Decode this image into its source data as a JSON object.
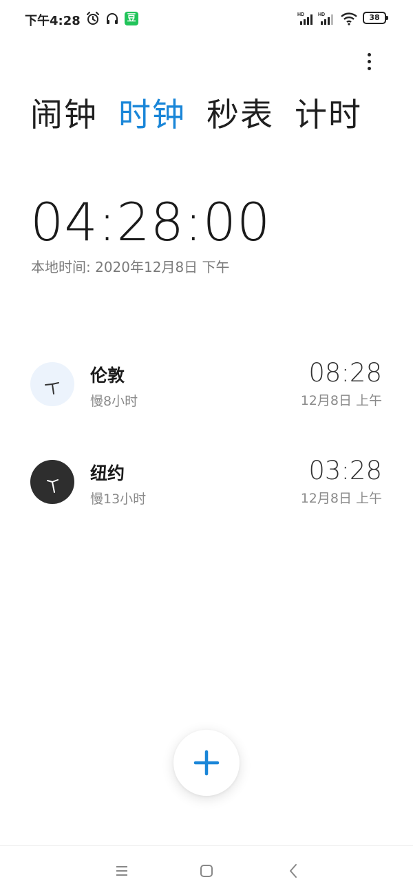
{
  "status_bar": {
    "time": "下午4:28",
    "app_badge": "豆",
    "battery": "38",
    "signal_label": "HD",
    "icons": [
      "alarm-icon",
      "headset-icon",
      "signal-icon",
      "wifi-icon",
      "battery-icon"
    ]
  },
  "tabs": [
    {
      "label": "闹钟",
      "active": false
    },
    {
      "label": "时钟",
      "active": true
    },
    {
      "label": "秒表",
      "active": false
    },
    {
      "label": "计时",
      "active": false
    }
  ],
  "local": {
    "time": "04:28:00",
    "date": "本地时间: 2020年12月8日 下午"
  },
  "world_clocks": [
    {
      "city": "伦敦",
      "offset": "慢8小时",
      "time": "08:28",
      "date": "12月8日 上午",
      "face": "light"
    },
    {
      "city": "纽约",
      "offset": "慢13小时",
      "time": "03:28",
      "date": "12月8日 上午",
      "face": "dark"
    }
  ],
  "fab": {
    "icon": "plus-icon"
  },
  "nav": {
    "icons": [
      "menu-icon",
      "home-icon",
      "back-icon"
    ]
  },
  "colors": {
    "accent": "#1a86d8",
    "text": "#1a1a1a",
    "secondary": "#8a8a8a",
    "badge": "#21c45a"
  }
}
